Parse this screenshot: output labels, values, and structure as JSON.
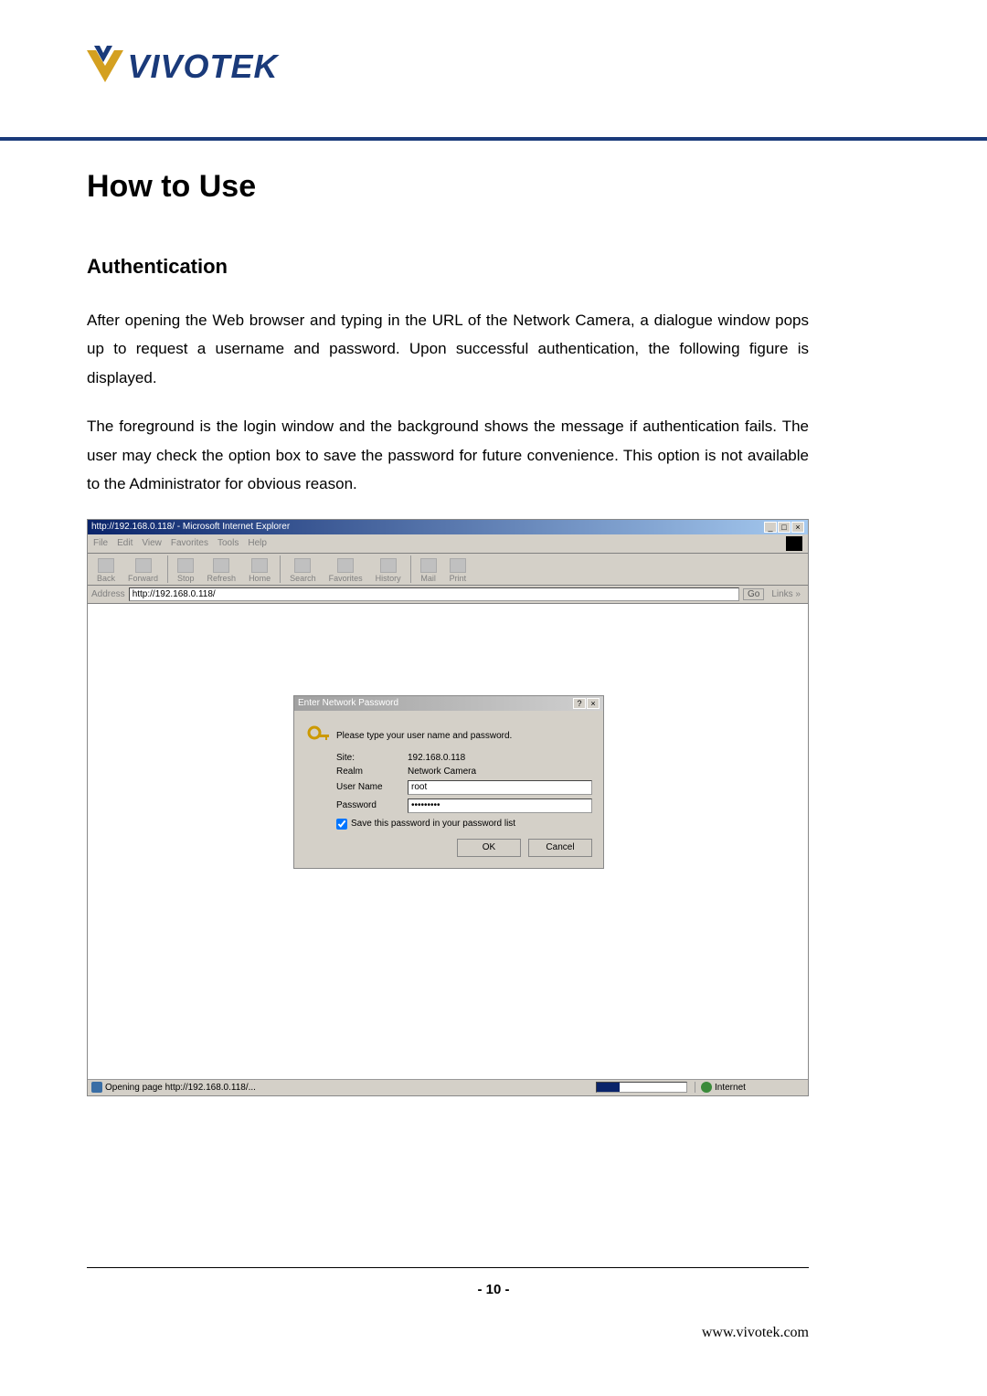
{
  "logo": {
    "text": "VIVOTEK"
  },
  "headline": "How to Use",
  "section": "Authentication",
  "para1": "After opening the Web browser and typing in the URL of the Network Camera, a dialogue window pops up to request a username and password. Upon successful authentication, the following figure is displayed.",
  "para2": "The foreground is the login window and the background shows the message if authentication fails. The user may check the option box to save the password for future convenience.  This option is not available to the Administrator for obvious reason.",
  "ie": {
    "title": "http://192.168.0.118/ - Microsoft Internet Explorer",
    "menu": {
      "file": "File",
      "edit": "Edit",
      "view": "View",
      "favorites": "Favorites",
      "tools": "Tools",
      "help": "Help"
    },
    "toolbar": {
      "back": "Back",
      "forward": "Forward",
      "stop": "Stop",
      "refresh": "Refresh",
      "home": "Home",
      "search": "Search",
      "favorites": "Favorites",
      "history": "History",
      "mail": "Mail",
      "print": "Print"
    },
    "address_label": "Address",
    "address_value": "http://192.168.0.118/",
    "go": "Go",
    "links": "Links »",
    "status_left": "Opening page http://192.168.0.118/...",
    "status_zone": "Internet"
  },
  "auth": {
    "title": "Enter Network Password",
    "prompt": "Please type your user name and password.",
    "site_label": "Site:",
    "site_value": "192.168.0.118",
    "realm_label": "Realm",
    "realm_value": "Network Camera",
    "user_label": "User Name",
    "user_value": "root",
    "pass_label": "Password",
    "pass_value": "•••••••••",
    "save_label": "Save this password in your password list",
    "ok": "OK",
    "cancel": "Cancel"
  },
  "page_number": "- 10 -",
  "footer_url": "www.vivotek.com"
}
